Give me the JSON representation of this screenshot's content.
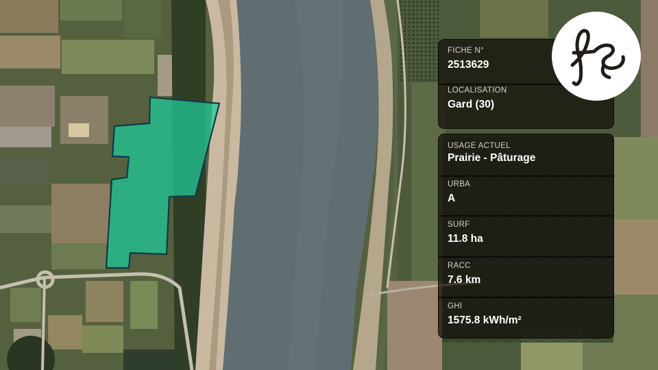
{
  "map": {
    "parcel_color": "#1fcc9a",
    "water_color": "#5f6c70"
  },
  "fiche": {
    "label": "FICHE N°",
    "value": "2513629"
  },
  "localisation": {
    "label": "LOCALISATION",
    "value": "Gard (30)"
  },
  "attributes": [
    {
      "label": "USAGE ACTUEL",
      "value": "Prairie - Pâturage"
    },
    {
      "label": "URBA",
      "value": "A"
    },
    {
      "label": "SURF",
      "value": "11.8 ha"
    },
    {
      "label": "RACC",
      "value": "7.6 km"
    },
    {
      "label": "GHI",
      "value": "1575.8 kWh/m²"
    }
  ],
  "logo": {
    "icon": "fs-monogram-logo"
  }
}
